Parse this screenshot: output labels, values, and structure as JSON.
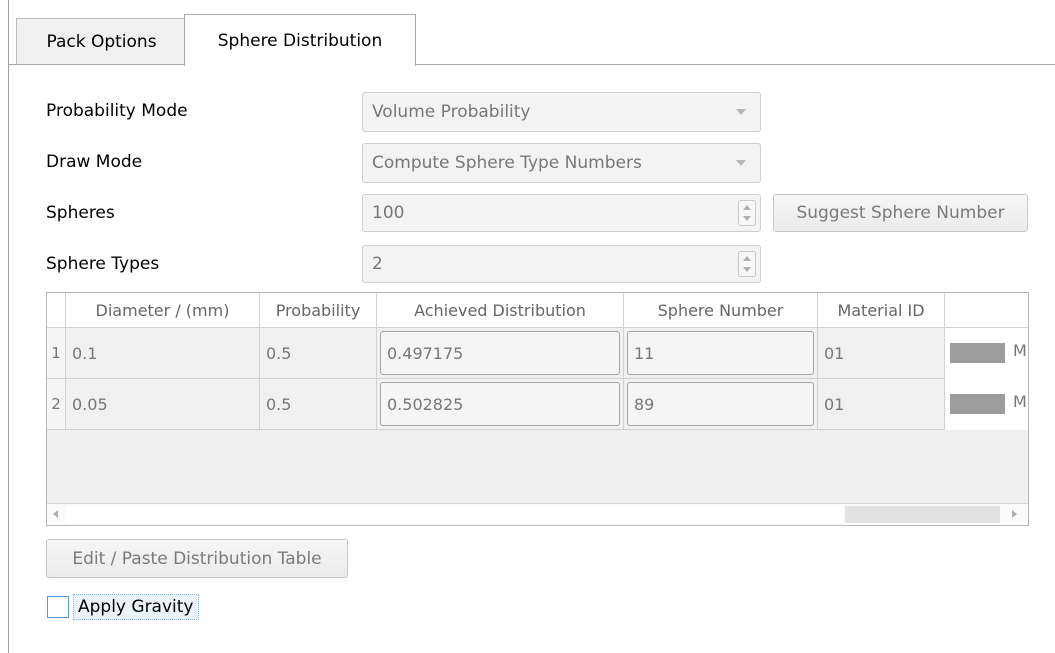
{
  "tabs": [
    {
      "label": "Pack Options",
      "active": false
    },
    {
      "label": "Sphere Distribution",
      "active": true
    }
  ],
  "form": {
    "probability_mode": {
      "label": "Probability Mode",
      "value": "Volume Probability"
    },
    "draw_mode": {
      "label": "Draw Mode",
      "value": "Compute Sphere Type Numbers"
    },
    "spheres": {
      "label": "Spheres",
      "value": "100"
    },
    "sphere_types": {
      "label": "Sphere Types",
      "value": "2"
    },
    "suggest_button": "Suggest Sphere Number"
  },
  "table": {
    "columns": [
      "Diameter / (mm)",
      "Probability",
      "Achieved Distribution",
      "Sphere Number",
      "Material ID"
    ],
    "rows": [
      {
        "index": "1",
        "diameter": "0.1",
        "probability": "0.5",
        "achieved": "0.497175",
        "sphere_number": "11",
        "material_id": "01",
        "material_color": "#9c9c9c",
        "material_text": "M"
      },
      {
        "index": "2",
        "diameter": "0.05",
        "probability": "0.5",
        "achieved": "0.502825",
        "sphere_number": "89",
        "material_id": "01",
        "material_color": "#9c9c9c",
        "material_text": "M"
      }
    ]
  },
  "edit_button": "Edit / Paste Distribution Table",
  "gravity": {
    "label": "Apply Gravity",
    "checked": false
  }
}
